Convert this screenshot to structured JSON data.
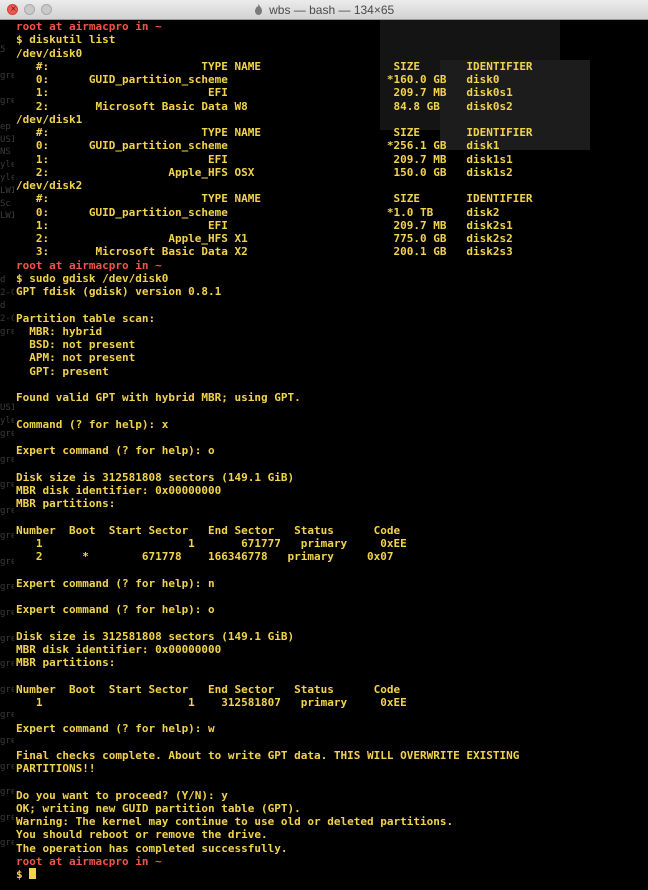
{
  "window": {
    "title": "wbs — bash — 134×65",
    "close_icon_glyph": "×"
  },
  "colors": {
    "text": "#f2d34e",
    "prompt": "#f0544a",
    "background": "#000000"
  },
  "left_edge_text": [
    "5",
    "",
    "gre",
    "",
    "gre",
    "",
    "ep",
    "USI",
    "NS",
    "yle",
    "yle",
    "LWI",
    "Sc",
    "LWI",
    "",
    "",
    "",
    "",
    "d",
    "2-C",
    "d",
    "2-C",
    "gre",
    "",
    "",
    "",
    "",
    "",
    "USI",
    "yle",
    "gre",
    "",
    "gre",
    "",
    "gre",
    "",
    "gre",
    "",
    "gre",
    "",
    "gre",
    "",
    "gre",
    "",
    "gre",
    "",
    "gre",
    "",
    "gre",
    "",
    "gre",
    "",
    "gre",
    "",
    "gre",
    "",
    "gre",
    "",
    "gre",
    "",
    "gre",
    "",
    "gre"
  ],
  "lines": [
    {
      "prompt": true,
      "text": "root at airmacpro in ~"
    },
    {
      "text": "$ diskutil list"
    },
    {
      "text": "/dev/disk0"
    },
    {
      "text": "   #:                       TYPE NAME                    SIZE       IDENTIFIER"
    },
    {
      "text": "   0:      GUID_partition_scheme                        *160.0 GB   disk0"
    },
    {
      "text": "   1:                        EFI                         209.7 MB   disk0s1"
    },
    {
      "text": "   2:       Microsoft Basic Data W8                      84.8 GB    disk0s2"
    },
    {
      "text": "/dev/disk1"
    },
    {
      "text": "   #:                       TYPE NAME                    SIZE       IDENTIFIER"
    },
    {
      "text": "   0:      GUID_partition_scheme                        *256.1 GB   disk1"
    },
    {
      "text": "   1:                        EFI                         209.7 MB   disk1s1"
    },
    {
      "text": "   2:                  Apple_HFS OSX                     150.0 GB   disk1s2"
    },
    {
      "text": "/dev/disk2"
    },
    {
      "text": "   #:                       TYPE NAME                    SIZE       IDENTIFIER"
    },
    {
      "text": "   0:      GUID_partition_scheme                        *1.0 TB     disk2"
    },
    {
      "text": "   1:                        EFI                         209.7 MB   disk2s1"
    },
    {
      "text": "   2:                  Apple_HFS X1                      775.0 GB   disk2s2"
    },
    {
      "text": "   3:       Microsoft Basic Data X2                      200.1 GB   disk2s3"
    },
    {
      "prompt": true,
      "text": "root at airmacpro in ~"
    },
    {
      "text": "$ sudo gdisk /dev/disk0"
    },
    {
      "text": "GPT fdisk (gdisk) version 0.8.1"
    },
    {
      "text": ""
    },
    {
      "text": "Partition table scan:"
    },
    {
      "text": "  MBR: hybrid"
    },
    {
      "text": "  BSD: not present"
    },
    {
      "text": "  APM: not present"
    },
    {
      "text": "  GPT: present"
    },
    {
      "text": ""
    },
    {
      "text": "Found valid GPT with hybrid MBR; using GPT."
    },
    {
      "text": ""
    },
    {
      "text": "Command (? for help): x"
    },
    {
      "text": ""
    },
    {
      "text": "Expert command (? for help): o"
    },
    {
      "text": ""
    },
    {
      "text": "Disk size is 312581808 sectors (149.1 GiB)"
    },
    {
      "text": "MBR disk identifier: 0x00000000"
    },
    {
      "text": "MBR partitions:"
    },
    {
      "text": ""
    },
    {
      "text": "Number  Boot  Start Sector   End Sector   Status      Code"
    },
    {
      "text": "   1                      1       671777   primary     0xEE"
    },
    {
      "text": "   2      *        671778    166346778   primary     0x07"
    },
    {
      "text": ""
    },
    {
      "text": "Expert command (? for help): n"
    },
    {
      "text": ""
    },
    {
      "text": "Expert command (? for help): o"
    },
    {
      "text": ""
    },
    {
      "text": "Disk size is 312581808 sectors (149.1 GiB)"
    },
    {
      "text": "MBR disk identifier: 0x00000000"
    },
    {
      "text": "MBR partitions:"
    },
    {
      "text": ""
    },
    {
      "text": "Number  Boot  Start Sector   End Sector   Status      Code"
    },
    {
      "text": "   1                      1    312581807   primary     0xEE"
    },
    {
      "text": ""
    },
    {
      "text": "Expert command (? for help): w"
    },
    {
      "text": ""
    },
    {
      "text": "Final checks complete. About to write GPT data. THIS WILL OVERWRITE EXISTING"
    },
    {
      "text": "PARTITIONS!!"
    },
    {
      "text": ""
    },
    {
      "text": "Do you want to proceed? (Y/N): y"
    },
    {
      "text": "OK; writing new GUID partition table (GPT)."
    },
    {
      "text": "Warning: The kernel may continue to use old or deleted partitions."
    },
    {
      "text": "You should reboot or remove the drive."
    },
    {
      "text": "The operation has completed successfully."
    },
    {
      "prompt": true,
      "text": "root at airmacpro in ~"
    },
    {
      "text": "$ ",
      "cursor": true
    }
  ]
}
